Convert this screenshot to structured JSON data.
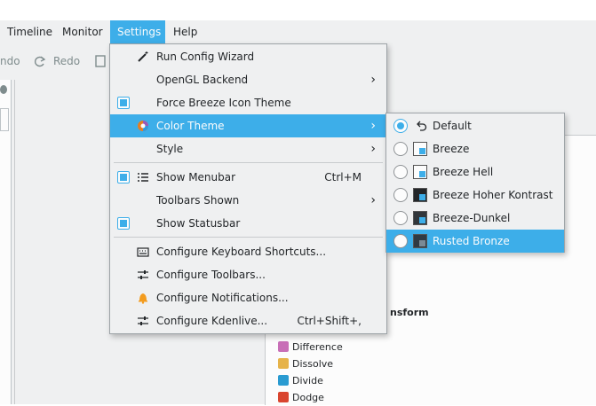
{
  "menubar": {
    "items": [
      "Timeline",
      "Monitor",
      "Settings",
      "Help"
    ]
  },
  "toolbar": {
    "undo_label": "ndo",
    "redo_label": "Redo"
  },
  "effects": {
    "heading": "nsform",
    "items": [
      {
        "label": "Difference",
        "color": "#c86fb7"
      },
      {
        "label": "Dissolve",
        "color": "#e6b34a"
      },
      {
        "label": "Divide",
        "color": "#2a9bd1"
      },
      {
        "label": "Dodge",
        "color": "#d9452f"
      }
    ]
  },
  "settings_menu": {
    "items": [
      {
        "label": "Run Config Wizard",
        "icon": "wand-icon"
      },
      {
        "label": "OpenGL Backend",
        "submenu": true
      },
      {
        "label": "Force Breeze Icon Theme",
        "checked": true
      },
      {
        "label": "Color Theme",
        "icon": "color-wheel-icon",
        "submenu": true,
        "highlighted": true
      },
      {
        "label": "Style",
        "submenu": true
      },
      {
        "label": "Show Menubar",
        "checked": true,
        "icon": "menubar-icon",
        "shortcut": "Ctrl+M"
      },
      {
        "label": "Toolbars Shown",
        "submenu": true
      },
      {
        "label": "Show Statusbar",
        "checked": true
      },
      {
        "label": "Configure Keyboard Shortcuts...",
        "icon": "keyboard-icon"
      },
      {
        "label": "Configure Toolbars...",
        "icon": "sliders-icon"
      },
      {
        "label": "Configure Notifications...",
        "icon": "bell-icon"
      },
      {
        "label": "Configure Kdenlive...",
        "icon": "sliders-icon",
        "shortcut": "Ctrl+Shift+,"
      }
    ]
  },
  "color_theme_menu": {
    "items": [
      {
        "label": "Default",
        "selected": true,
        "icon": "undo-icon"
      },
      {
        "label": "Breeze"
      },
      {
        "label": "Breeze Hell"
      },
      {
        "label": "Breeze Hoher Kontrast"
      },
      {
        "label": "Breeze-Dunkel"
      },
      {
        "label": "Rusted Bronze",
        "highlighted": true
      }
    ]
  },
  "colors": {
    "accent": "#3daee9",
    "window_bg": "#eff0f1"
  }
}
